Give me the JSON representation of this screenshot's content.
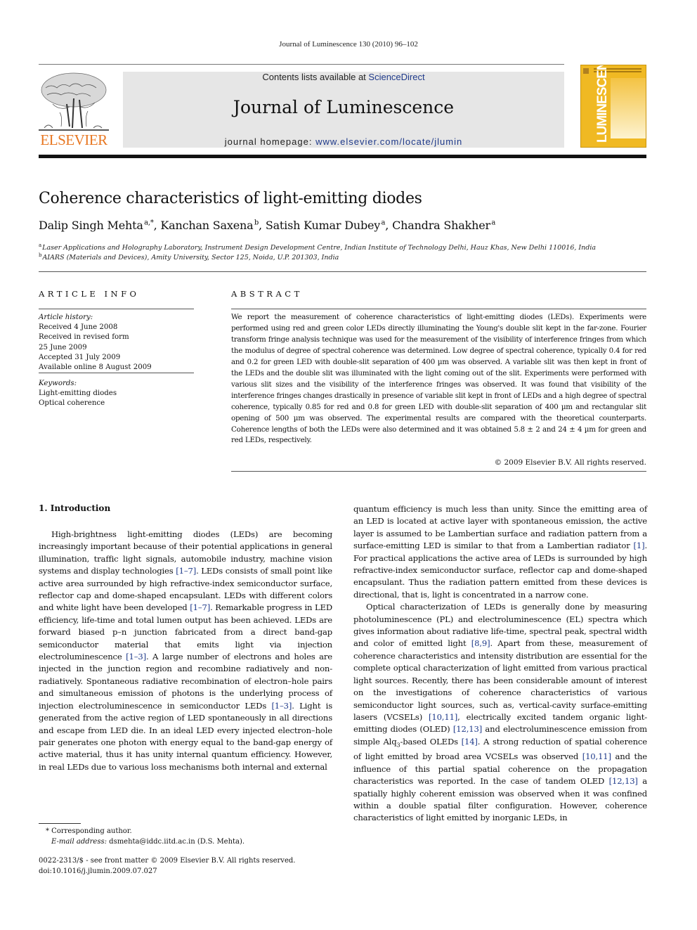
{
  "running_head": "Journal of Luminescence 130 (2010) 96–102",
  "header": {
    "publisher_logo_text": "ELSEVIER",
    "contents_prefix": "Contents lists available at ",
    "contents_link": "ScienceDirect",
    "journal_title": "Journal of Luminescence",
    "homepage_prefix": "journal homepage: ",
    "homepage_link": "www.elsevier.com/locate/jlumin",
    "cover_title": "LUMINESCENCE",
    "cover_subtitle": "JOURNAL OF",
    "colors": {
      "elsevier_orange": "#e87722",
      "link_blue": "#1f3a8a",
      "cover_yellow": "#f0b923",
      "banner_gray": "#e6e6e6"
    }
  },
  "article": {
    "title": "Coherence characteristics of light-emitting diodes",
    "authors": [
      {
        "name": "Dalip Singh Mehta",
        "sup": "a,*"
      },
      {
        "name": "Kanchan Saxena",
        "sup": "b"
      },
      {
        "name": "Satish Kumar Dubey",
        "sup": "a"
      },
      {
        "name": "Chandra Shakher",
        "sup": "a"
      }
    ],
    "affiliations": [
      {
        "sup": "a",
        "text": "Laser Applications and Holography Laboratory, Instrument Design Development Centre, Indian Institute of Technology Delhi, Hauz Khas, New Delhi 110016, India"
      },
      {
        "sup": "b",
        "text": "AIARS (Materials and Devices), Amity University, Sector 125, Noida, U.P. 201303, India"
      }
    ]
  },
  "article_info": {
    "heading": "ARTICLE INFO",
    "history_label": "Article history:",
    "history": [
      "Received 4 June 2008",
      "Received in revised form",
      "25 June 2009",
      "Accepted 31 July 2009",
      "Available online 8 August 2009"
    ],
    "keywords_label": "Keywords:",
    "keywords": [
      "Light-emitting diodes",
      "Optical coherence"
    ]
  },
  "abstract": {
    "heading": "ABSTRACT",
    "text": "We report the measurement of coherence characteristics of light-emitting diodes (LEDs). Experiments were performed using red and green color LEDs directly illuminating the Young's double slit kept in the far-zone. Fourier transform fringe analysis technique was used for the measurement of the visibility of interference fringes from which the modulus of degree of spectral coherence was determined. Low degree of spectral coherence, typically 0.4 for red and 0.2 for green LED with double-slit separation of 400 µm was observed. A variable slit was then kept in front of the LEDs and the double slit was illuminated with the light coming out of the slit. Experiments were performed with various slit sizes and the visibility of the interference fringes was observed. It was found that visibility of the interference fringes changes drastically in presence of variable slit kept in front of LEDs and a high degree of spectral coherence, typically 0.85 for red and 0.8 for green LED with double-slit separation of 400 µm and rectangular slit opening of 500 µm was observed. The experimental results are compared with the theoretical counterparts. Coherence lengths of both the LEDs were also determined and it was obtained 5.8 ± 2 and 24 ± 4 µm for green and red LEDs, respectively.",
    "copyright": "© 2009 Elsevier B.V. All rights reserved."
  },
  "introduction": {
    "heading": "1.  Introduction",
    "left_col": [
      {
        "t": "High-brightness light-emitting diodes (LEDs) are becoming increasingly important because of their potential applications in general illumination, traffic light signals, automobile industry, machine vision systems and display technologies "
      },
      {
        "r": "[1–7]"
      },
      {
        "t": ". LEDs consists of small point like active area surrounded by high refractive-index semiconductor surface, reflector cap and dome-shaped encapsulant. LEDs with different colors and white light have been developed "
      },
      {
        "r": "[1–7]"
      },
      {
        "t": ". Remarkable progress in LED efficiency, life-time and total lumen output has been achieved. LEDs are forward biased p–n junction fabricated from a direct band-gap semiconductor material that emits light via injection electroluminescence "
      },
      {
        "r": "[1–3]"
      },
      {
        "t": ". A large number of electrons and holes are injected in the junction region and recombine radiatively and non-radiatively. Spontaneous radiative recombination of electron–hole pairs and simultaneous emission of photons is the underlying process of injection electroluminescence in semiconductor LEDs "
      },
      {
        "r": "[1–3]"
      },
      {
        "t": ". Light is generated from the active region of LED spontaneously in all directions and escape from LED die. In an ideal LED every injected electron–hole pair generates one photon with energy equal to the band-gap energy of active material, thus it has unity internal quantum efficiency. However, in real LEDs due to various loss mechanisms both internal and external"
      }
    ],
    "right_col_p1": [
      {
        "t": "quantum efficiency is much less than unity. Since the emitting area of an LED is located at active layer with spontaneous emission, the active layer is assumed to be Lambertian surface and radiation pattern from a surface-emitting LED is similar to that from a Lambertian radiator "
      },
      {
        "r": "[1]"
      },
      {
        "t": ". For practical applications the active area of LEDs is surrounded by high refractive-index semiconductor surface, reflector cap and dome-shaped encapsulant. Thus the radiation pattern emitted from these devices is directional, that is, light is concentrated in a narrow cone."
      }
    ],
    "right_col_p2": [
      {
        "t": "Optical characterization of LEDs is generally done by measuring photoluminescence (PL) and electroluminescence (EL) spectra which gives information about radiative life-time, spectral peak, spectral width and color of emitted light "
      },
      {
        "r": "[8,9]"
      },
      {
        "t": ". Apart from these, measurement of coherence characteristics and intensity distribution are essential for the complete optical characterization of light emitted from various practical light sources. Recently, there has been considerable amount of interest on the investigations of coherence characteristics of various semiconductor light sources, such as, vertical-cavity surface-emitting lasers (VCSELs) "
      },
      {
        "r": "[10,11]"
      },
      {
        "t": ", electrically excited tandem organic light-emitting diodes (OLED) "
      },
      {
        "r": "[12,13]"
      },
      {
        "t": " and electroluminescence emission from simple Alq"
      },
      {
        "sub": "3"
      },
      {
        "t": "-based OLEDs "
      },
      {
        "r": "[14]"
      },
      {
        "t": ". A strong reduction of spatial coherence of light emitted by broad area VCSELs was observed "
      },
      {
        "r": "[10,11]"
      },
      {
        "t": " and the influence of this partial spatial coherence on the propagation characteristics was reported. In the case of tandem OLED "
      },
      {
        "r": "[12,13]"
      },
      {
        "t": " a spatially highly coherent emission was observed when it was confined within a double spatial filter configuration. However, coherence characteristics of light emitted by inorganic LEDs, in"
      }
    ]
  },
  "footnotes": {
    "corresponding": "* Corresponding author.",
    "email_label": "E-mail address:",
    "email": " dsmehta@iddc.iitd.ac.in (D.S. Mehta).",
    "issn_line": "0022-2313/$ - see front matter © 2009 Elsevier B.V. All rights reserved.",
    "doi": "doi:10.1016/j.jlumin.2009.07.027"
  }
}
